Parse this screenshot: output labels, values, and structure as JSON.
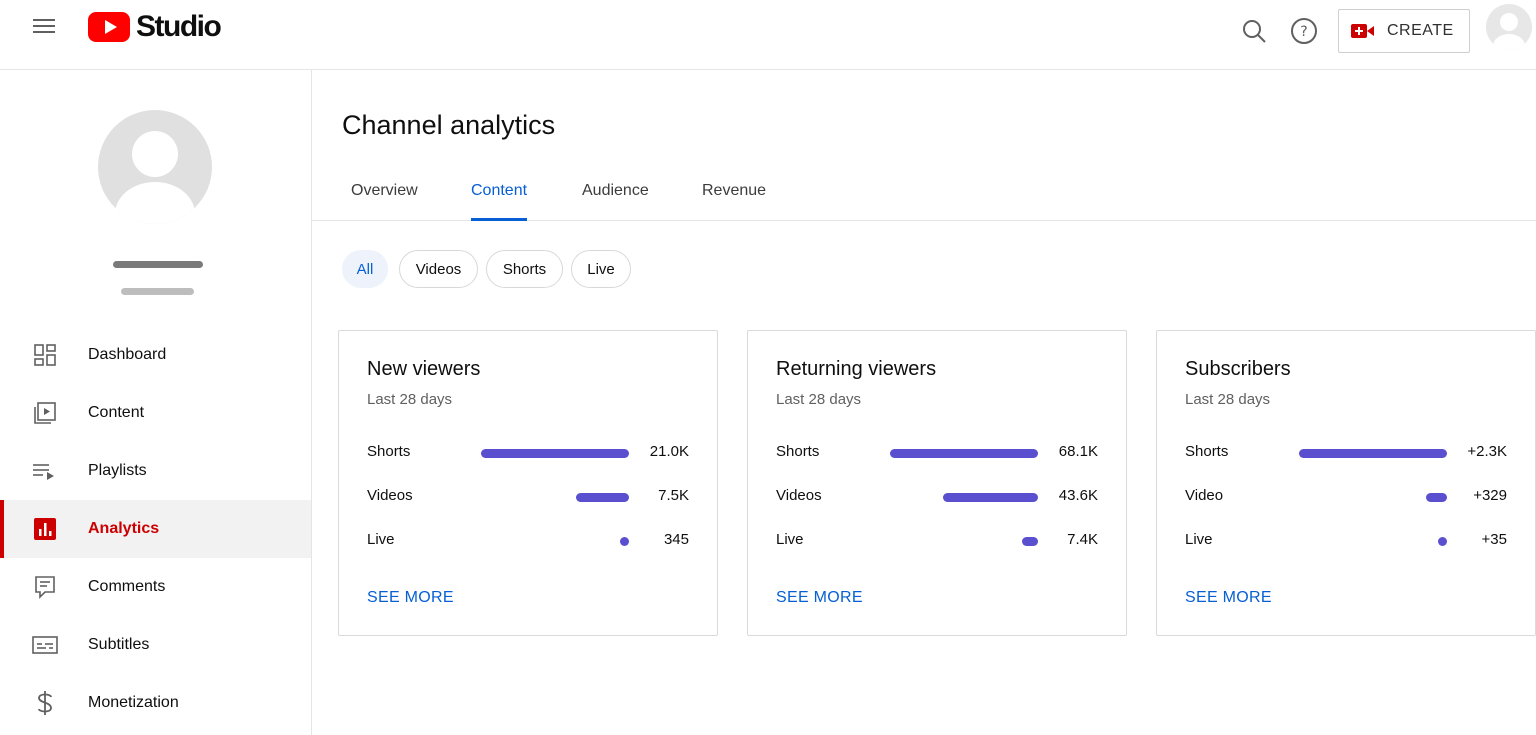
{
  "header": {
    "logo_text": "Studio",
    "create_label": "CREATE",
    "icons": [
      "menu-icon",
      "youtube-logo-icon",
      "search-icon",
      "help-icon",
      "create-video-icon",
      "account-avatar-icon"
    ],
    "colors": {
      "brand": "#ff0000",
      "accent": "#065fd4",
      "active_nav": "#cc0000",
      "bar": "#5a4fcf"
    }
  },
  "sidebar": {
    "items": [
      {
        "label": "Dashboard",
        "icon": "dashboard-icon"
      },
      {
        "label": "Content",
        "icon": "content-icon"
      },
      {
        "label": "Playlists",
        "icon": "playlists-icon"
      },
      {
        "label": "Analytics",
        "icon": "analytics-icon",
        "active": true
      },
      {
        "label": "Comments",
        "icon": "comments-icon"
      },
      {
        "label": "Subtitles",
        "icon": "subtitles-icon"
      },
      {
        "label": "Monetization",
        "icon": "monetization-icon"
      }
    ]
  },
  "main": {
    "title": "Channel analytics",
    "tabs": [
      {
        "label": "Overview"
      },
      {
        "label": "Content",
        "active": true
      },
      {
        "label": "Audience"
      },
      {
        "label": "Revenue"
      }
    ],
    "chips": [
      {
        "label": "All",
        "active": true
      },
      {
        "label": "Videos"
      },
      {
        "label": "Shorts"
      },
      {
        "label": "Live"
      }
    ],
    "cards": [
      {
        "title": "New viewers",
        "subtitle": "Last 28 days",
        "see_more": "SEE MORE",
        "rows": [
          {
            "label": "Shorts",
            "value": "21.0K",
            "fraction": 1.0
          },
          {
            "label": "Videos",
            "value": "7.5K",
            "fraction": 0.36
          },
          {
            "label": "Live",
            "value": "345",
            "fraction": 0.016
          }
        ]
      },
      {
        "title": "Returning viewers",
        "subtitle": "Last 28 days",
        "see_more": "SEE MORE",
        "rows": [
          {
            "label": "Shorts",
            "value": "68.1K",
            "fraction": 1.0
          },
          {
            "label": "Videos",
            "value": "43.6K",
            "fraction": 0.64
          },
          {
            "label": "Live",
            "value": "7.4K",
            "fraction": 0.11
          }
        ]
      },
      {
        "title": "Subscribers",
        "subtitle": "Last 28 days",
        "see_more": "SEE MORE",
        "rows": [
          {
            "label": "Shorts",
            "value": "+2.3K",
            "fraction": 1.0
          },
          {
            "label": "Video",
            "value": "+329",
            "fraction": 0.14
          },
          {
            "label": "Live",
            "value": "+35",
            "fraction": 0.015
          }
        ]
      }
    ]
  }
}
